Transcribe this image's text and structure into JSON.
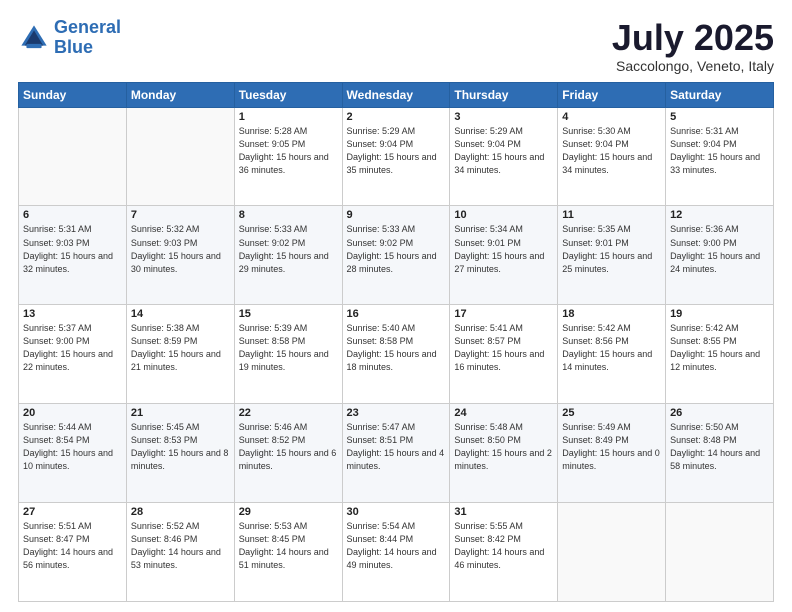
{
  "logo": {
    "line1": "General",
    "line2": "Blue"
  },
  "header": {
    "month": "July 2025",
    "location": "Saccolongo, Veneto, Italy"
  },
  "weekdays": [
    "Sunday",
    "Monday",
    "Tuesday",
    "Wednesday",
    "Thursday",
    "Friday",
    "Saturday"
  ],
  "weeks": [
    [
      {
        "day": "",
        "sunrise": "",
        "sunset": "",
        "daylight": ""
      },
      {
        "day": "",
        "sunrise": "",
        "sunset": "",
        "daylight": ""
      },
      {
        "day": "1",
        "sunrise": "Sunrise: 5:28 AM",
        "sunset": "Sunset: 9:05 PM",
        "daylight": "Daylight: 15 hours and 36 minutes."
      },
      {
        "day": "2",
        "sunrise": "Sunrise: 5:29 AM",
        "sunset": "Sunset: 9:04 PM",
        "daylight": "Daylight: 15 hours and 35 minutes."
      },
      {
        "day": "3",
        "sunrise": "Sunrise: 5:29 AM",
        "sunset": "Sunset: 9:04 PM",
        "daylight": "Daylight: 15 hours and 34 minutes."
      },
      {
        "day": "4",
        "sunrise": "Sunrise: 5:30 AM",
        "sunset": "Sunset: 9:04 PM",
        "daylight": "Daylight: 15 hours and 34 minutes."
      },
      {
        "day": "5",
        "sunrise": "Sunrise: 5:31 AM",
        "sunset": "Sunset: 9:04 PM",
        "daylight": "Daylight: 15 hours and 33 minutes."
      }
    ],
    [
      {
        "day": "6",
        "sunrise": "Sunrise: 5:31 AM",
        "sunset": "Sunset: 9:03 PM",
        "daylight": "Daylight: 15 hours and 32 minutes."
      },
      {
        "day": "7",
        "sunrise": "Sunrise: 5:32 AM",
        "sunset": "Sunset: 9:03 PM",
        "daylight": "Daylight: 15 hours and 30 minutes."
      },
      {
        "day": "8",
        "sunrise": "Sunrise: 5:33 AM",
        "sunset": "Sunset: 9:02 PM",
        "daylight": "Daylight: 15 hours and 29 minutes."
      },
      {
        "day": "9",
        "sunrise": "Sunrise: 5:33 AM",
        "sunset": "Sunset: 9:02 PM",
        "daylight": "Daylight: 15 hours and 28 minutes."
      },
      {
        "day": "10",
        "sunrise": "Sunrise: 5:34 AM",
        "sunset": "Sunset: 9:01 PM",
        "daylight": "Daylight: 15 hours and 27 minutes."
      },
      {
        "day": "11",
        "sunrise": "Sunrise: 5:35 AM",
        "sunset": "Sunset: 9:01 PM",
        "daylight": "Daylight: 15 hours and 25 minutes."
      },
      {
        "day": "12",
        "sunrise": "Sunrise: 5:36 AM",
        "sunset": "Sunset: 9:00 PM",
        "daylight": "Daylight: 15 hours and 24 minutes."
      }
    ],
    [
      {
        "day": "13",
        "sunrise": "Sunrise: 5:37 AM",
        "sunset": "Sunset: 9:00 PM",
        "daylight": "Daylight: 15 hours and 22 minutes."
      },
      {
        "day": "14",
        "sunrise": "Sunrise: 5:38 AM",
        "sunset": "Sunset: 8:59 PM",
        "daylight": "Daylight: 15 hours and 21 minutes."
      },
      {
        "day": "15",
        "sunrise": "Sunrise: 5:39 AM",
        "sunset": "Sunset: 8:58 PM",
        "daylight": "Daylight: 15 hours and 19 minutes."
      },
      {
        "day": "16",
        "sunrise": "Sunrise: 5:40 AM",
        "sunset": "Sunset: 8:58 PM",
        "daylight": "Daylight: 15 hours and 18 minutes."
      },
      {
        "day": "17",
        "sunrise": "Sunrise: 5:41 AM",
        "sunset": "Sunset: 8:57 PM",
        "daylight": "Daylight: 15 hours and 16 minutes."
      },
      {
        "day": "18",
        "sunrise": "Sunrise: 5:42 AM",
        "sunset": "Sunset: 8:56 PM",
        "daylight": "Daylight: 15 hours and 14 minutes."
      },
      {
        "day": "19",
        "sunrise": "Sunrise: 5:42 AM",
        "sunset": "Sunset: 8:55 PM",
        "daylight": "Daylight: 15 hours and 12 minutes."
      }
    ],
    [
      {
        "day": "20",
        "sunrise": "Sunrise: 5:44 AM",
        "sunset": "Sunset: 8:54 PM",
        "daylight": "Daylight: 15 hours and 10 minutes."
      },
      {
        "day": "21",
        "sunrise": "Sunrise: 5:45 AM",
        "sunset": "Sunset: 8:53 PM",
        "daylight": "Daylight: 15 hours and 8 minutes."
      },
      {
        "day": "22",
        "sunrise": "Sunrise: 5:46 AM",
        "sunset": "Sunset: 8:52 PM",
        "daylight": "Daylight: 15 hours and 6 minutes."
      },
      {
        "day": "23",
        "sunrise": "Sunrise: 5:47 AM",
        "sunset": "Sunset: 8:51 PM",
        "daylight": "Daylight: 15 hours and 4 minutes."
      },
      {
        "day": "24",
        "sunrise": "Sunrise: 5:48 AM",
        "sunset": "Sunset: 8:50 PM",
        "daylight": "Daylight: 15 hours and 2 minutes."
      },
      {
        "day": "25",
        "sunrise": "Sunrise: 5:49 AM",
        "sunset": "Sunset: 8:49 PM",
        "daylight": "Daylight: 15 hours and 0 minutes."
      },
      {
        "day": "26",
        "sunrise": "Sunrise: 5:50 AM",
        "sunset": "Sunset: 8:48 PM",
        "daylight": "Daylight: 14 hours and 58 minutes."
      }
    ],
    [
      {
        "day": "27",
        "sunrise": "Sunrise: 5:51 AM",
        "sunset": "Sunset: 8:47 PM",
        "daylight": "Daylight: 14 hours and 56 minutes."
      },
      {
        "day": "28",
        "sunrise": "Sunrise: 5:52 AM",
        "sunset": "Sunset: 8:46 PM",
        "daylight": "Daylight: 14 hours and 53 minutes."
      },
      {
        "day": "29",
        "sunrise": "Sunrise: 5:53 AM",
        "sunset": "Sunset: 8:45 PM",
        "daylight": "Daylight: 14 hours and 51 minutes."
      },
      {
        "day": "30",
        "sunrise": "Sunrise: 5:54 AM",
        "sunset": "Sunset: 8:44 PM",
        "daylight": "Daylight: 14 hours and 49 minutes."
      },
      {
        "day": "31",
        "sunrise": "Sunrise: 5:55 AM",
        "sunset": "Sunset: 8:42 PM",
        "daylight": "Daylight: 14 hours and 46 minutes."
      },
      {
        "day": "",
        "sunrise": "",
        "sunset": "",
        "daylight": ""
      },
      {
        "day": "",
        "sunrise": "",
        "sunset": "",
        "daylight": ""
      }
    ]
  ]
}
